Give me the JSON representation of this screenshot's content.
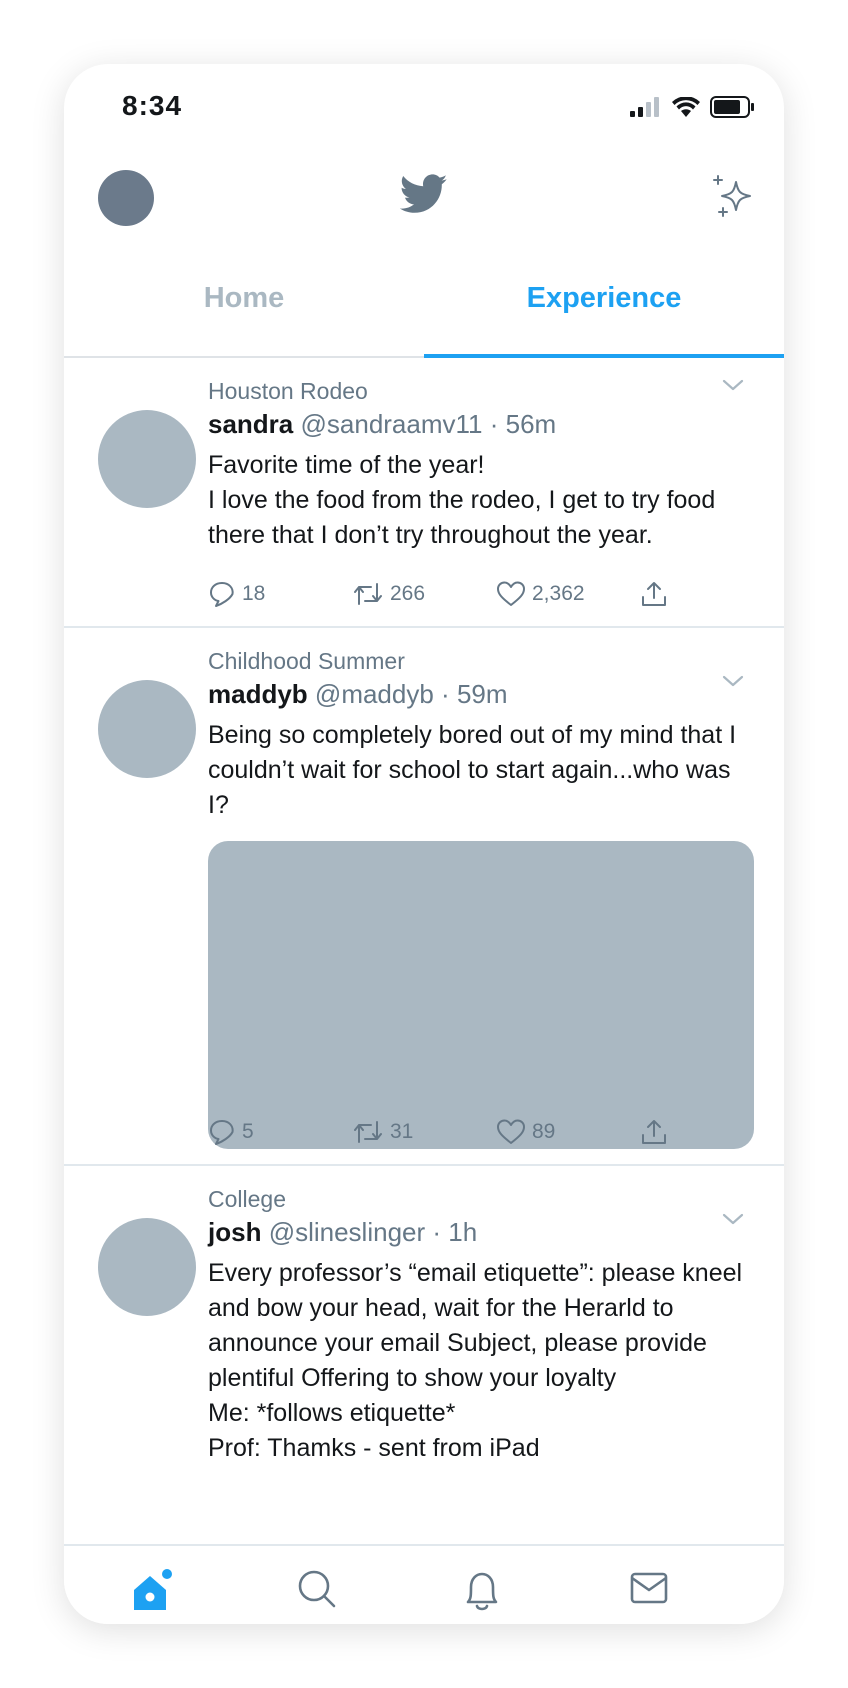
{
  "status_bar": {
    "time": "8:34"
  },
  "tabs": {
    "home": "Home",
    "experience": "Experience",
    "active": "Experience"
  },
  "tweets": [
    {
      "context": "Houston Rodeo",
      "name": "sandra",
      "handle": "@sandraamv11",
      "time": "56m",
      "text": "Favorite time of the year!\nI love the food from the rodeo, I get to try food there that I don’t try throughout the year.",
      "replies": "18",
      "retweets": "266",
      "likes": "2,362"
    },
    {
      "context": "Childhood Summer",
      "name": "maddyb",
      "handle": "@maddyb",
      "time": "59m",
      "text": "Being so completely bored out of my mind that I couldn’t wait for school to start again...who was I?",
      "replies": "5",
      "retweets": "31",
      "likes": "89"
    },
    {
      "context": "College",
      "name": "josh",
      "handle": "@slineslinger",
      "time": "1h",
      "text": "Every professor’s “email etiquette”: please kneel and bow your head, wait for the Herarld to announce your email Subject, please provide plentiful Offering to show your loyalty\nMe: *follows etiquette*\nProf: Thamks - sent from iPad"
    }
  ],
  "colors": {
    "accent": "#1da1f2",
    "secondary_text": "#657786",
    "placeholder": "#aab8c2"
  },
  "icons": [
    "avatar",
    "twitter-bird-icon",
    "sparkle-icon",
    "caret-down-icon",
    "reply-icon",
    "retweet-icon",
    "like-icon",
    "share-icon",
    "home-icon",
    "search-icon",
    "bell-icon",
    "mail-icon"
  ]
}
